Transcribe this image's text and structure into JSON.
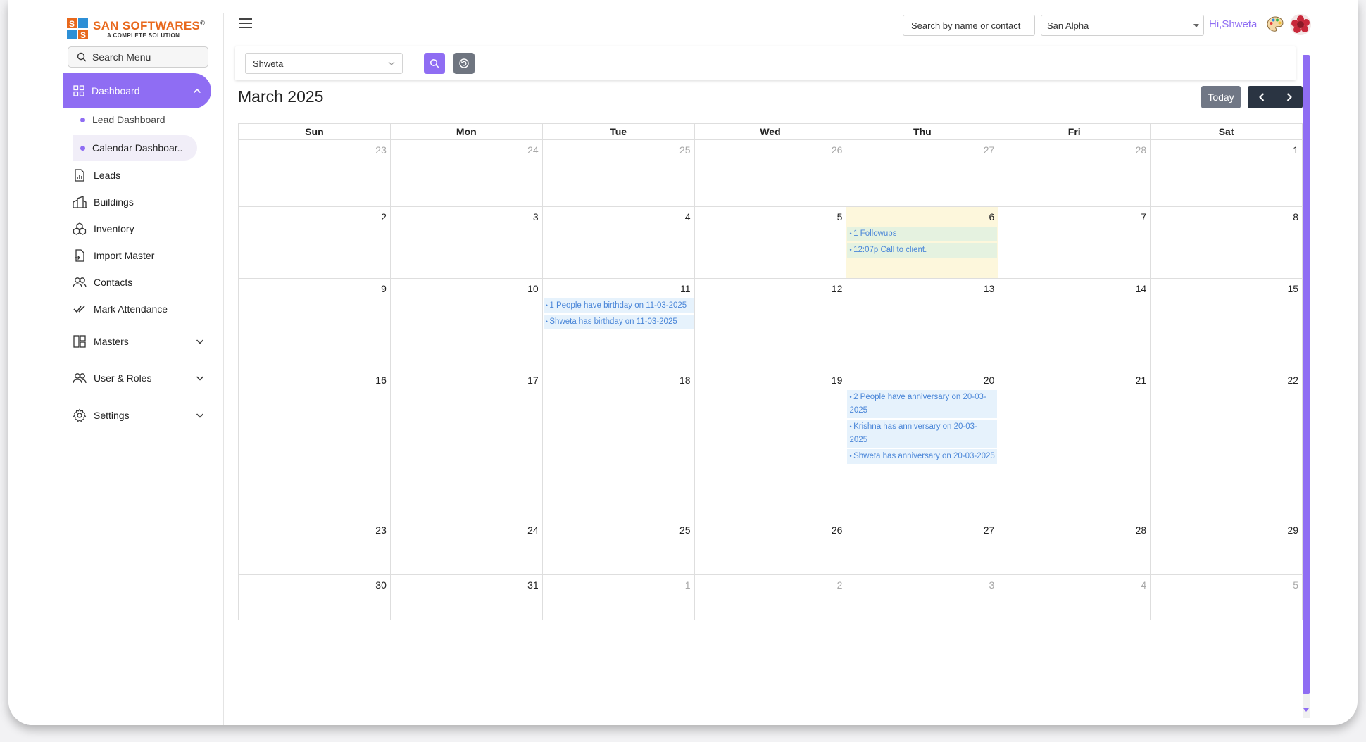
{
  "brand": {
    "name": "SAN SOFTWARES",
    "registered": "®",
    "tagline": "A COMPLETE SOLUTION",
    "accent": "#8f6df3",
    "logo_color": "#e8681c"
  },
  "sidebar": {
    "search_label": "Search Menu",
    "dashboard_label": "Dashboard",
    "sub_items": [
      {
        "label": "Lead Dashboard"
      },
      {
        "label": "Calendar Dashboar.."
      }
    ],
    "items": [
      {
        "label": "Leads",
        "icon": "chart-icon"
      },
      {
        "label": "Buildings",
        "icon": "buildings-icon"
      },
      {
        "label": "Inventory",
        "icon": "inventory-icon"
      },
      {
        "label": "Import Master",
        "icon": "import-icon"
      },
      {
        "label": "Contacts",
        "icon": "contacts-icon"
      },
      {
        "label": "Mark Attendance",
        "icon": "check-icon"
      },
      {
        "label": "Masters",
        "icon": "masters-icon"
      },
      {
        "label": "User & Roles",
        "icon": "users-icon"
      },
      {
        "label": "Settings",
        "icon": "gear-icon"
      }
    ]
  },
  "header": {
    "search_placeholder": "Search by name or contact",
    "company": "San Alpha",
    "greeting": "Hi,Shweta"
  },
  "filter": {
    "user": "Shweta"
  },
  "calendar": {
    "title": "March 2025",
    "today_label": "Today",
    "weekdays": [
      "Sun",
      "Mon",
      "Tue",
      "Wed",
      "Thu",
      "Fri",
      "Sat"
    ],
    "weeks": [
      {
        "days": [
          {
            "num": "23",
            "other": true,
            "events": []
          },
          {
            "num": "24",
            "other": true,
            "events": []
          },
          {
            "num": "25",
            "other": true,
            "events": []
          },
          {
            "num": "26",
            "other": true,
            "events": []
          },
          {
            "num": "27",
            "other": true,
            "events": []
          },
          {
            "num": "28",
            "other": true,
            "events": []
          },
          {
            "num": "1",
            "other": false,
            "events": []
          }
        ]
      },
      {
        "days": [
          {
            "num": "2",
            "other": false,
            "events": []
          },
          {
            "num": "3",
            "other": false,
            "events": []
          },
          {
            "num": "4",
            "other": false,
            "events": []
          },
          {
            "num": "5",
            "other": false,
            "events": []
          },
          {
            "num": "6",
            "other": false,
            "today": true,
            "events": [
              {
                "text": "1 Followups",
                "color": "green"
              },
              {
                "text": "12:07p Call to client.",
                "color": "green"
              }
            ]
          },
          {
            "num": "7",
            "other": false,
            "events": []
          },
          {
            "num": "8",
            "other": false,
            "events": []
          }
        ]
      },
      {
        "days": [
          {
            "num": "9",
            "other": false,
            "events": []
          },
          {
            "num": "10",
            "other": false,
            "events": []
          },
          {
            "num": "11",
            "other": false,
            "events": [
              {
                "text": "1 People have birthday on 11-03-2025",
                "color": "blue"
              },
              {
                "text": "Shweta has birthday on 11-03-2025",
                "color": "blue"
              }
            ]
          },
          {
            "num": "12",
            "other": false,
            "events": []
          },
          {
            "num": "13",
            "other": false,
            "events": []
          },
          {
            "num": "14",
            "other": false,
            "events": []
          },
          {
            "num": "15",
            "other": false,
            "events": []
          }
        ]
      },
      {
        "days": [
          {
            "num": "16",
            "other": false,
            "events": []
          },
          {
            "num": "17",
            "other": false,
            "events": []
          },
          {
            "num": "18",
            "other": false,
            "events": []
          },
          {
            "num": "19",
            "other": false,
            "events": []
          },
          {
            "num": "20",
            "other": false,
            "events": [
              {
                "text": "2 People have anniversary on 20-03-2025",
                "color": "blue"
              },
              {
                "text": "Krishna has anniversary on 20-03-2025",
                "color": "blue"
              },
              {
                "text": "Shweta has anniversary on 20-03-2025",
                "color": "blue"
              }
            ]
          },
          {
            "num": "21",
            "other": false,
            "events": []
          },
          {
            "num": "22",
            "other": false,
            "events": []
          }
        ]
      },
      {
        "days": [
          {
            "num": "23",
            "other": false,
            "events": []
          },
          {
            "num": "24",
            "other": false,
            "events": []
          },
          {
            "num": "25",
            "other": false,
            "events": []
          },
          {
            "num": "26",
            "other": false,
            "events": []
          },
          {
            "num": "27",
            "other": false,
            "events": []
          },
          {
            "num": "28",
            "other": false,
            "events": []
          },
          {
            "num": "29",
            "other": false,
            "events": []
          }
        ]
      },
      {
        "days": [
          {
            "num": "30",
            "other": false,
            "events": []
          },
          {
            "num": "31",
            "other": false,
            "events": []
          },
          {
            "num": "1",
            "other": true,
            "events": []
          },
          {
            "num": "2",
            "other": true,
            "events": []
          },
          {
            "num": "3",
            "other": true,
            "events": []
          },
          {
            "num": "4",
            "other": true,
            "events": []
          },
          {
            "num": "5",
            "other": true,
            "events": []
          }
        ]
      }
    ]
  }
}
